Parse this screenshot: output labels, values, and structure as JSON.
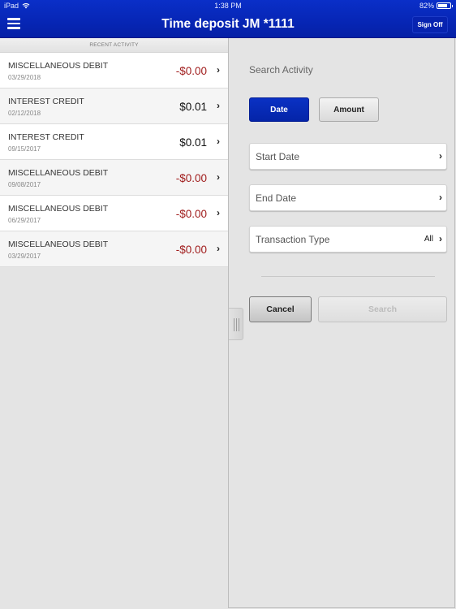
{
  "status_bar": {
    "device": "iPad",
    "time": "1:38 PM",
    "battery_percent": "82%",
    "battery_level": 0.82
  },
  "header": {
    "title": "Time deposit JM *1111",
    "sign_off_label": "Sign Off",
    "menu_icon": "hamburger-menu-icon"
  },
  "recent_activity": {
    "section_label": "RECENT ACTIVITY",
    "items": [
      {
        "name": "MISCELLANEOUS DEBIT",
        "date": "03/29/2018",
        "amount": "-$0.00",
        "type": "debit"
      },
      {
        "name": "INTEREST CREDIT",
        "date": "02/12/2018",
        "amount": "$0.01",
        "type": "credit"
      },
      {
        "name": "INTEREST CREDIT",
        "date": "09/15/2017",
        "amount": "$0.01",
        "type": "credit"
      },
      {
        "name": "MISCELLANEOUS DEBIT",
        "date": "09/08/2017",
        "amount": "-$0.00",
        "type": "debit"
      },
      {
        "name": "MISCELLANEOUS DEBIT",
        "date": "06/29/2017",
        "amount": "-$0.00",
        "type": "debit"
      },
      {
        "name": "MISCELLANEOUS DEBIT",
        "date": "03/29/2017",
        "amount": "-$0.00",
        "type": "debit"
      }
    ]
  },
  "search": {
    "title": "Search Activity",
    "toggle": {
      "date_label": "Date",
      "amount_label": "Amount",
      "selected": "Date"
    },
    "fields": {
      "start_date_label": "Start Date",
      "end_date_label": "End Date",
      "transaction_type_label": "Transaction Type",
      "transaction_type_value": "All"
    },
    "cancel_label": "Cancel",
    "search_label": "Search"
  },
  "icons": {
    "chevron": "›"
  },
  "colors": {
    "brand_blue": "#0727b8",
    "debit_red": "#a01c1c"
  }
}
